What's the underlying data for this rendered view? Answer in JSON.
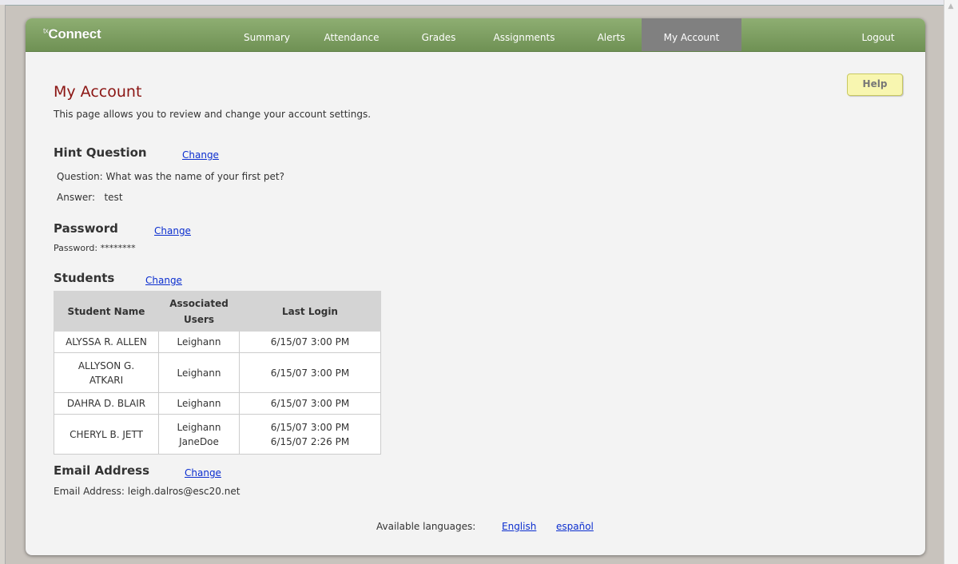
{
  "app": {
    "logo_prefix": "tx",
    "logo_name": "Connect"
  },
  "nav": {
    "items": [
      {
        "label": "Summary"
      },
      {
        "label": "Attendance"
      },
      {
        "label": "Grades"
      },
      {
        "label": "Assignments"
      },
      {
        "label": "Alerts"
      },
      {
        "label": "My Account",
        "active": true
      },
      {
        "label": "Logout"
      }
    ]
  },
  "page": {
    "title": "My Account",
    "intro": "This page allows you to review and change your account settings.",
    "help_label": "Help"
  },
  "hint": {
    "heading": "Hint Question",
    "change_label": "Change",
    "question": "Question: What was the name of your first pet?",
    "answer": "Answer:   test"
  },
  "password": {
    "heading": "Password",
    "change_label": "Change",
    "value": "Password: ********"
  },
  "students": {
    "heading": "Students",
    "change_label": "Change",
    "columns": [
      "Student Name",
      "Associated\nUsers",
      "Last Login"
    ],
    "rows": [
      {
        "name": "ALYSSA R. ALLEN",
        "users": "Leighann",
        "login": "6/15/07 3:00 PM"
      },
      {
        "name": "ALLYSON G.\nATKARI",
        "users": "Leighann",
        "login": "6/15/07 3:00 PM"
      },
      {
        "name": "DAHRA D. BLAIR",
        "users": "Leighann",
        "login": "6/15/07 3:00 PM"
      },
      {
        "name": "CHERYL B. JETT",
        "users": "Leighann\nJaneDoe",
        "login": "6/15/07 3:00 PM\n6/15/07 2:26 PM"
      }
    ]
  },
  "email": {
    "heading": "Email Address",
    "change_label": "Change",
    "value": "Email Address: leigh.dalros@esc20.net"
  },
  "languages": {
    "label": "Available languages:",
    "options": [
      "English",
      "español"
    ]
  },
  "colors": {
    "nav_bg": "#7f9f62",
    "nav_active": "#808080",
    "title": "#8b1513",
    "link": "#0b2ecf",
    "help_bg": "#f8f6b0"
  }
}
